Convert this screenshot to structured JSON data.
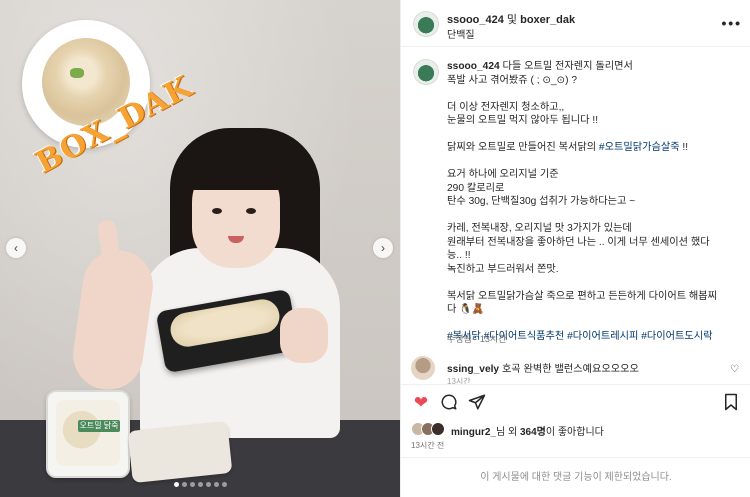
{
  "post": {
    "logo_text": "BOX_DAK",
    "carousel": {
      "dot_count": 7,
      "active_index": 0
    },
    "package_label": "오트밀 닭죽"
  },
  "header": {
    "user1": "ssooo_424",
    "and_text": " 및 ",
    "user2": "boxer_dak",
    "subtitle": "단백질",
    "more_icon": "more-dots-icon"
  },
  "caption": {
    "username": "ssooo_424",
    "line1": " 다들 오트밀 전자렌지 돌리면서",
    "line2": "폭발 사고 겪어봤쥬 ( ; ⊙_⊙) ?",
    "line3": "더 이상 전자렌지 청소하고,,",
    "line4": "눈물의 오트밀 먹지 않아두 됩니다 !!",
    "line5": "닭찌와 오트밀로 만들어진 복서닭의 ",
    "line5_tag": "#오트밀닭가슴살죽",
    "line5_end": " !!",
    "line6": "요거 하나에 오리지널 기준",
    "line7": "290 칼로리로",
    "line8": "탄수 30g, 단백질30g 섭취가 가능하다는고 ~",
    "line9": "카레, 전복내장, 오리지널 맛 3가지가 있는데",
    "line10": "원래부터 전복내장을 좋아하던 나는 .. 이게 너무 센세이션 했다",
    "line11": "능.. !!",
    "line12": "녹진하고 부드러워서 쫀맛.",
    "line13": "복서닭 오트밀닭가슴살 죽으로 편하고 든든하게 다이어트 해봅찌",
    "line14": "다 🐧🧸",
    "tags": "#복서닭 #다이어트식품추천 #다이어트레시피 #다이어트도시락",
    "meta": "수정됨 · 13시간"
  },
  "comment": {
    "username": "ssing_vely",
    "text": " 호곡 완벽한 밸런스예요오오오오",
    "sub": "13시간"
  },
  "actions": {
    "likes_user": "mingur2_",
    "likes_mid": "님 외 ",
    "likes_count": "364명",
    "likes_end": "이 좋아합니다",
    "time": "13시간 전"
  },
  "footer": {
    "limited": "이 게시물에 대한 댓글 기능이 제한되었습니다."
  },
  "colors": {
    "heart": "#ed4956",
    "hashtag": "#00376b",
    "logo": "#f7a334"
  }
}
